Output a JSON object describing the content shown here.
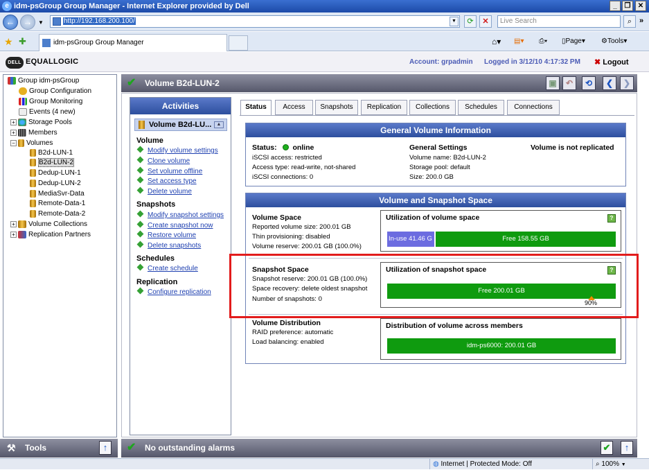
{
  "browser": {
    "title": "idm-psGroup Group Manager - Internet Explorer provided by Dell",
    "url": "http://192.168.200.100/",
    "search_placeholder": "Live Search",
    "tab_title": "idm-psGroup Group Manager",
    "cmd_page": "Page",
    "cmd_tools": "Tools",
    "status_zone": "Internet | Protected Mode: Off",
    "zoom": "100%"
  },
  "header": {
    "logo_text": "EQUALLOGIC",
    "logo_badge": "DELL",
    "account": "Account: grpadmin",
    "logged_in": "Logged in 3/12/10 4:17:32 PM",
    "logout": "Logout"
  },
  "tree": {
    "items": [
      {
        "label": "Group idm-psGroup"
      },
      {
        "label": "Group Configuration"
      },
      {
        "label": "Group Monitoring"
      },
      {
        "label": "Events (4 new)"
      },
      {
        "label": "Storage Pools"
      },
      {
        "label": "Members"
      },
      {
        "label": "Volumes"
      },
      {
        "label": "B2d-LUN-1"
      },
      {
        "label": "B2d-LUN-2"
      },
      {
        "label": "Dedup-LUN-1"
      },
      {
        "label": "Dedup-LUN-2"
      },
      {
        "label": "MediaSvr-Data"
      },
      {
        "label": "Remote-Data-1"
      },
      {
        "label": "Remote-Data-2"
      },
      {
        "label": "Volume Collections"
      },
      {
        "label": "Replication Partners"
      }
    ]
  },
  "tools_label": "Tools",
  "alarm_text": "No outstanding alarms",
  "volume_title": "Volume B2d-LUN-2",
  "activities": {
    "title": "Activities",
    "selected": "Volume B2d-LU...",
    "sections": {
      "volume": "Volume",
      "snapshots": "Snapshots",
      "schedules": "Schedules",
      "replication": "Replication"
    },
    "links": {
      "modify_settings": "Modify volume settings",
      "clone": "Clone volume",
      "offline": "Set volume offline",
      "access_type": "Set access type",
      "delete_volume": "Delete volume",
      "modify_snap": "Modify snapshot settings",
      "create_snap": "Create snapshot now",
      "restore": "Restore volume",
      "delete_snaps": "Delete snapshots",
      "create_schedule": "Create schedule",
      "configure_repl": "Configure replication"
    }
  },
  "tabs": [
    "Status",
    "Access",
    "Snapshots",
    "Replication",
    "Collections",
    "Schedules",
    "Connections"
  ],
  "general": {
    "title": "General Volume Information",
    "status_label": "Status:",
    "status_value": "online",
    "iscsi_access": "iSCSI access:  restricted",
    "access_type": "Access type:  read-write, not-shared",
    "iscsi_conn": "iSCSI connections:  0",
    "settings_title": "General Settings",
    "volume_name": "Volume name:  B2d-LUN-2",
    "storage_pool": "Storage pool:  default",
    "size": "Size:  200.0 GB",
    "replication": "Volume is not replicated"
  },
  "space": {
    "title": "Volume and Snapshot Space",
    "vol_title": "Volume Space",
    "reported": "Reported volume size:  200.01 GB",
    "thin": "Thin provisioning:  disabled",
    "reserve": "Volume reserve:  200.01 GB (100.0%)",
    "util_vol_title": "Utilization of volume space",
    "inuse_label": "In-use 41.46 G",
    "inuse_fraction": 0.207,
    "free_label": "Free 158.55 GB",
    "snap_title": "Snapshot Space",
    "snap_reserve": "Snapshot reserve:  200.01 GB (100.0%)",
    "space_recovery": "Space recovery:  delete oldest snapshot",
    "num_snaps": "Number of snapshots:  0",
    "util_snap_title": "Utilization of snapshot space",
    "snap_free_label": "Free 200.01 GB",
    "snap_marker": "90%",
    "dist_title": "Volume Distribution",
    "raid": "RAID preference:  automatic",
    "lb": "Load balancing:  enabled",
    "dist_box_title": "Distribution of volume across members",
    "dist_bar": "idm-ps6000: 200.01 GB"
  },
  "colors": {
    "accent_blue": "#2d4f9e",
    "bar_green": "#0f9b0f",
    "bar_inuse": "#6c6ce0",
    "annotation_red": "#e21c1c"
  }
}
